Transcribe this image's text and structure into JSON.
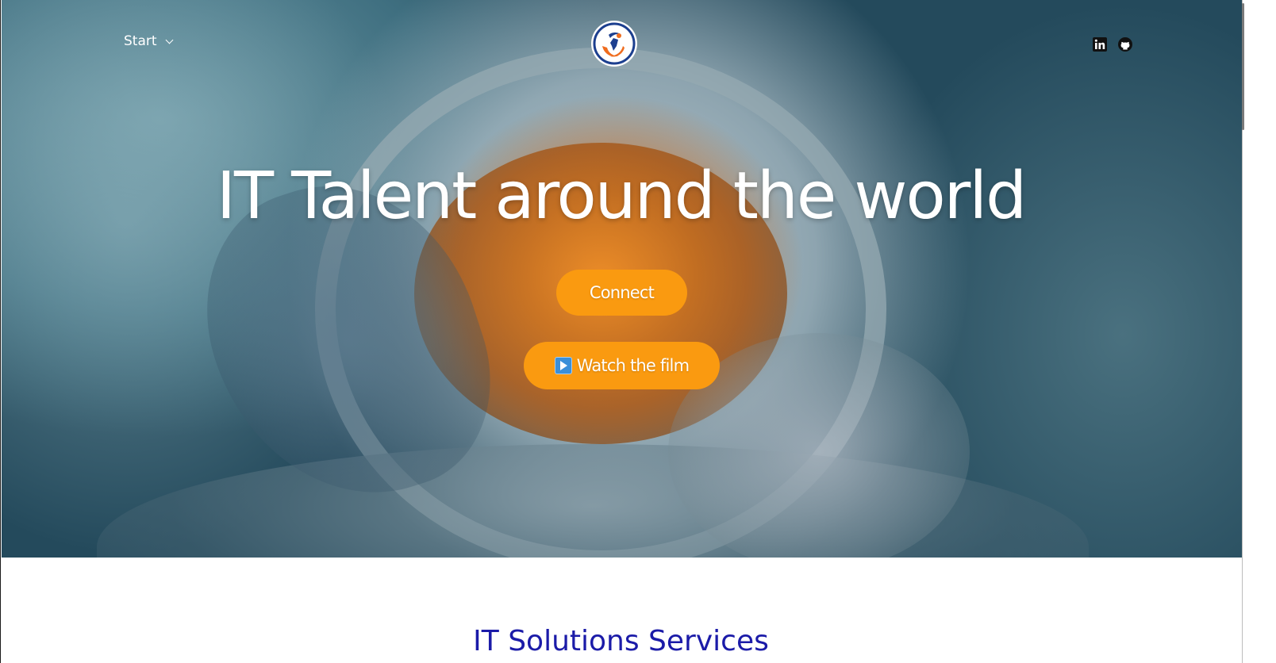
{
  "nav": {
    "start_label": "Start"
  },
  "hero": {
    "headline": "IT Talent around the world",
    "connect_label": "Connect",
    "watch_film_label": "Watch the film",
    "play_icon": "play-button-emoji"
  },
  "social": {
    "linkedin_icon": "linkedin-icon",
    "github_icon": "github-icon"
  },
  "section": {
    "title": "IT Solutions Services"
  },
  "colors": {
    "accent_orange": "#fa9a10",
    "section_title_blue": "#1b1ba8",
    "logo_blue": "#1c3f8f",
    "logo_orange": "#ef6c1e"
  }
}
